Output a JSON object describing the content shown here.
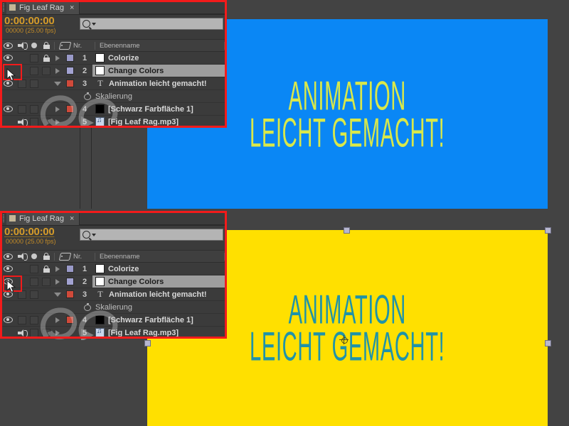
{
  "app": {
    "background_color": "#434343",
    "panel_color": "#3b3b3b",
    "accent_timecode_color": "#d49b2a",
    "annotation_color": "#f31b1b"
  },
  "panels": [
    {
      "id": "top",
      "tab": {
        "title": "Fig Leaf Rag",
        "close_label": "×",
        "icon": "composition-square-icon"
      },
      "timecode": {
        "value": "0:00:00:00",
        "frames_fps": "00000 (25.00 fps)"
      },
      "search": {
        "value": "",
        "placeholder": "",
        "icon": "search-icon",
        "dropdown_icon": "chevron-down-icon"
      },
      "columns": {
        "video_icon": "eye-icon",
        "audio_icon": "speaker-icon",
        "solo_icon": "solo-dot-icon",
        "lock_icon": "lock-icon",
        "label_icon": "label-tag-icon",
        "number": "Nr.",
        "name": "Ebenenname"
      },
      "layers": [
        {
          "number": "1",
          "name": "Colorize",
          "visible": true,
          "audio": false,
          "locked": true,
          "label_color": "#9a9ac8",
          "source_swatch": "#ffffff",
          "type_icon": "none",
          "expanded": false,
          "selected": false
        },
        {
          "number": "2",
          "name": "Change Colors",
          "visible": false,
          "audio": false,
          "locked": false,
          "label_color": "#9a9ac8",
          "source_swatch": "#ffffff",
          "type_icon": "none",
          "expanded": false,
          "selected": true
        },
        {
          "number": "3",
          "name": "Animation leicht gemacht!",
          "visible": true,
          "audio": false,
          "locked": false,
          "label_color": "#d04a3a",
          "source_swatch": "none",
          "type_icon": "T",
          "expanded": true,
          "selected": false
        },
        {
          "number": "4",
          "name": "[Schwarz Farbfläche 1]",
          "visible": true,
          "audio": false,
          "locked": false,
          "label_color": "#d04a3a",
          "source_swatch": "#000000",
          "type_icon": "none",
          "expanded": false,
          "selected": false
        },
        {
          "number": "5",
          "name": "[Fig Leaf Rag.mp3]",
          "visible": false,
          "audio": true,
          "locked": false,
          "label_color": "none",
          "source_swatch": "audio",
          "type_icon": "none",
          "expanded": false,
          "selected": false
        }
      ],
      "property_row": {
        "name": "Skalierung",
        "stopwatch_icon": "stopwatch-icon"
      }
    },
    {
      "id": "bottom",
      "tab": {
        "title": "Fig Leaf Rag",
        "close_label": "×",
        "icon": "composition-square-icon"
      },
      "timecode": {
        "value": "0:00:00:00",
        "frames_fps": "00000 (25.00 fps)"
      },
      "search": {
        "value": "",
        "placeholder": "",
        "icon": "search-icon",
        "dropdown_icon": "chevron-down-icon"
      },
      "columns": {
        "video_icon": "eye-icon",
        "audio_icon": "speaker-icon",
        "solo_icon": "solo-dot-icon",
        "lock_icon": "lock-icon",
        "label_icon": "label-tag-icon",
        "number": "Nr.",
        "name": "Ebenenname"
      },
      "layers": [
        {
          "number": "1",
          "name": "Colorize",
          "visible": true,
          "audio": false,
          "locked": true,
          "label_color": "#9a9ac8",
          "source_swatch": "#ffffff",
          "type_icon": "none",
          "expanded": false,
          "selected": false
        },
        {
          "number": "2",
          "name": "Change Colors",
          "visible": true,
          "audio": false,
          "locked": false,
          "label_color": "#9a9ac8",
          "source_swatch": "#ffffff",
          "type_icon": "none",
          "expanded": false,
          "selected": true
        },
        {
          "number": "3",
          "name": "Animation leicht gemacht!",
          "visible": true,
          "audio": false,
          "locked": false,
          "label_color": "#d04a3a",
          "source_swatch": "none",
          "type_icon": "T",
          "expanded": true,
          "selected": false
        },
        {
          "number": "4",
          "name": "[Schwarz Farbfläche 1]",
          "visible": true,
          "audio": false,
          "locked": false,
          "label_color": "#d04a3a",
          "source_swatch": "#000000",
          "type_icon": "none",
          "expanded": false,
          "selected": false
        },
        {
          "number": "5",
          "name": "[Fig Leaf Rag.mp3]",
          "visible": false,
          "audio": true,
          "locked": false,
          "label_color": "none",
          "source_swatch": "audio",
          "type_icon": "none",
          "expanded": false,
          "selected": false
        }
      ],
      "property_row": {
        "name": "Skalierung",
        "stopwatch_icon": "stopwatch-icon"
      }
    }
  ],
  "compositions": [
    {
      "id": "blue-comp",
      "background_color": "#0a87f5",
      "text_color": "#d9e84a",
      "line1": "ANIMATION",
      "line2": "LEICHT GEMACHT!",
      "selected": false
    },
    {
      "id": "yellow-comp",
      "background_color": "#ffe000",
      "text_color": "#1f93a8",
      "line1": "ANIMATION",
      "line2": "LEICHT GEMACHT!",
      "selected": true,
      "handle_color": "#b7b7cf"
    }
  ]
}
